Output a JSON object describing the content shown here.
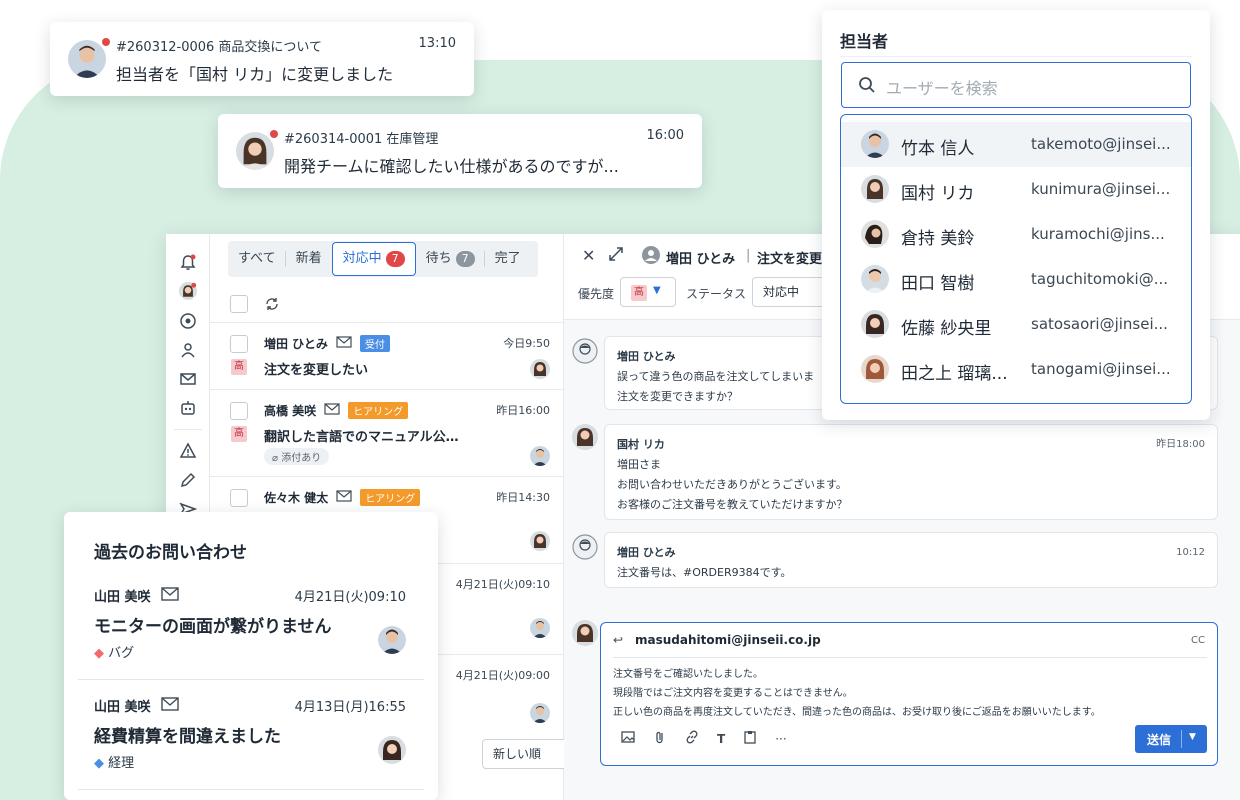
{
  "colors": {
    "accent": "#2c6fd6",
    "alert": "#e04848",
    "background_blob": "#d7efe2",
    "tag_red": "#f06b6b",
    "tag_blue": "#4a8ee6"
  },
  "toasts": [
    {
      "ticket": "#260312-0006 商品交換について",
      "time": "13:10",
      "message": "担当者を「国村 リカ」に変更しました"
    },
    {
      "ticket": "#260314-0001 在庫管理",
      "time": "16:00",
      "message": "開発チームに確認したい仕様があるのですが..."
    }
  ],
  "tabs": [
    {
      "label": "すべて"
    },
    {
      "label": "新着"
    },
    {
      "label": "対応中",
      "count": "7"
    },
    {
      "label": "待ち",
      "count": "7"
    },
    {
      "label": "完了"
    }
  ],
  "list": [
    {
      "name": "増田 ひとみ",
      "status": "受付",
      "time": "今日9:50",
      "priority": "高",
      "subject": "注文を変更したい"
    },
    {
      "name": "高橋 美咲",
      "status": "ヒアリング",
      "time": "昨日16:00",
      "priority": "高",
      "subject": "翻訳した言語でのマニュアル公…",
      "attachment": "添付あり"
    },
    {
      "name": "佐々木 健太",
      "status": "ヒアリング",
      "time": "昨日14:30"
    },
    {
      "time": "4月21日(火)09:10"
    },
    {
      "time": "4月21日(火)09:00"
    }
  ],
  "sort": {
    "label": "新しい順"
  },
  "detail": {
    "customer": "増田 ひとみ",
    "title": "注文を変更",
    "priority_label": "優先度",
    "priority_value": "高",
    "status_label": "ステータス",
    "status_value": "対応中"
  },
  "messages": [
    {
      "name": "増田 ひとみ",
      "time": "",
      "lines": [
        "誤って違う色の商品を注文してしまいま",
        "注文を変更できますか？"
      ]
    },
    {
      "name": "国村 リカ",
      "time": "昨日18:00",
      "lines": [
        "増田さま",
        "お問い合わせいただきありがとうございます。",
        "お客様のご注文番号を教えていただけますか？"
      ]
    },
    {
      "name": "増田 ひとみ",
      "time": "10:12",
      "lines": [
        "注文番号は、#ORDER9384です。"
      ]
    }
  ],
  "compose": {
    "to": "masudahitomi@jinseii.co.jp",
    "cc": "CC",
    "lines": [
      "注文番号をご確認いたしました。",
      "現段階ではご注文内容を変更することはできません。",
      "正しい色の商品を再度注文していただき、間違った色の商品は、お受け取り後にご返品をお願いいたします。"
    ],
    "send": "送信",
    "more": "···"
  },
  "assignee": {
    "title": "担当者",
    "search_placeholder": "ユーザーを検索",
    "users": [
      {
        "name": "竹本 信人",
        "email": "takemoto@jinsei..."
      },
      {
        "name": "国村 リカ",
        "email": "kunimura@jinsei..."
      },
      {
        "name": "倉持 美鈴",
        "email": "kuramochi@jins..."
      },
      {
        "name": "田口 智樹",
        "email": "taguchitomoki@..."
      },
      {
        "name": "佐藤 紗央里",
        "email": "satosaori@jinsei..."
      },
      {
        "name": "田之上 瑠璃...",
        "email": "tanogami@jinsei..."
      }
    ]
  },
  "past": {
    "title": "過去のお問い合わせ",
    "items": [
      {
        "name": "山田 美咲",
        "time": "4月21日(火)09:10",
        "subject": "モニターの画面が繋がりません",
        "tag": "バグ"
      },
      {
        "name": "山田 美咲",
        "time": "4月13日(月)16:55",
        "subject": "経費精算を間違えました",
        "tag": "経理"
      }
    ]
  }
}
